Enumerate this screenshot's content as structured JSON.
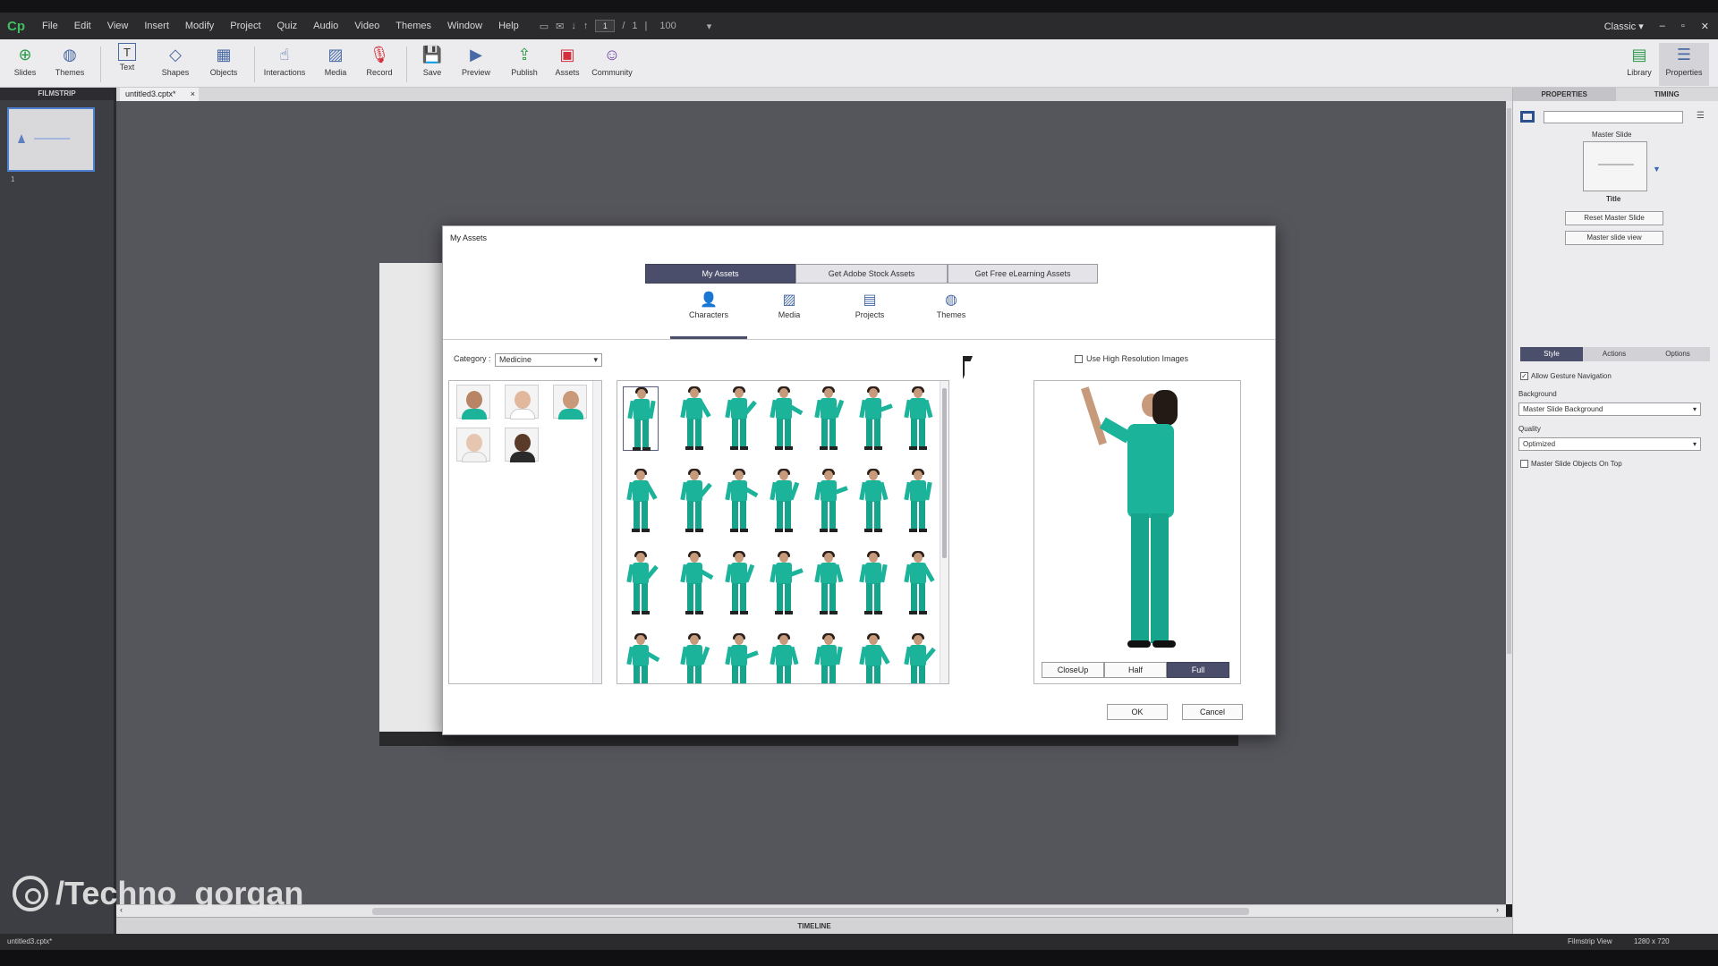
{
  "app": {
    "logo": "Cp",
    "menu": [
      "File",
      "Edit",
      "View",
      "Insert",
      "Modify",
      "Project",
      "Quiz",
      "Audio",
      "Video",
      "Themes",
      "Window",
      "Help"
    ],
    "page_current": "1",
    "page_sep": "/",
    "page_total": "1",
    "zoom": "100",
    "workspace": "Classic"
  },
  "toolbar": {
    "slides": "Slides",
    "themes": "Themes",
    "text": "Text",
    "shapes": "Shapes",
    "objects": "Objects",
    "interactions": "Interactions",
    "media": "Media",
    "record": "Record",
    "save": "Save",
    "preview": "Preview",
    "publish": "Publish",
    "assets": "Assets",
    "community": "Community",
    "library": "Library",
    "properties": "Properties"
  },
  "filmstrip": {
    "header": "FILMSTRIP",
    "slide_number": "1"
  },
  "document": {
    "tab_name": "untitled3.cptx*",
    "close": "×"
  },
  "properties": {
    "tab_properties": "PROPERTIES",
    "tab_timing": "TIMING",
    "master_label": "Master Slide",
    "master_name": "Title",
    "reset_btn": "Reset Master Slide",
    "view_btn": "Master slide view",
    "seg_style": "Style",
    "seg_actions": "Actions",
    "seg_options": "Options",
    "gesture_label": "Allow Gesture Navigation",
    "gesture_checked": "✓",
    "background_label": "Background",
    "background_value": "Master Slide Background",
    "quality_label": "Quality",
    "quality_value": "Optimized",
    "objects_on_top": "Master Slide Objects On Top"
  },
  "dialog": {
    "title": "My Assets",
    "seg_my": "My Assets",
    "seg_stock": "Get Adobe Stock Assets",
    "seg_free": "Get Free eLearning Assets",
    "tab_characters": "Characters",
    "tab_media": "Media",
    "tab_projects": "Projects",
    "tab_themes": "Themes",
    "category_label": "Category :",
    "category_value": "Medicine",
    "hires_label": "Use High Resolution Images",
    "view_closeup": "CloseUp",
    "view_half": "Half",
    "view_full": "Full",
    "ok": "OK",
    "cancel": "Cancel"
  },
  "timeline": {
    "label": "TIMELINE"
  },
  "status": {
    "file": "untitled3.cptx*",
    "view": "Filmstrip View",
    "resolution": "1280 x 720"
  },
  "watermark": {
    "text": "/Techno_gorgan"
  },
  "colors": {
    "accent": "#4a4e6a",
    "scrubs": "#1bb39a",
    "logo": "#3fbf5f"
  }
}
